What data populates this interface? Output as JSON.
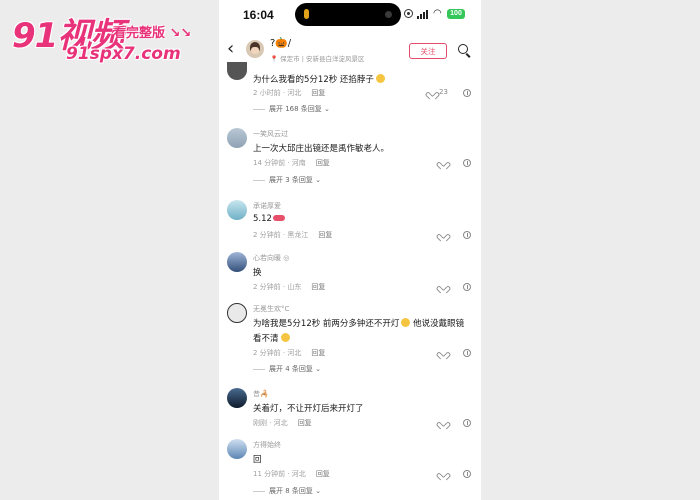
{
  "watermark": {
    "main": "91视频",
    "side": "看完整版 ↘↘",
    "url": "91spx7.com"
  },
  "status": {
    "time": "16:04",
    "battery": "100"
  },
  "header": {
    "back": "‹",
    "name": "?🎃/",
    "sub": "📍 保定市 | 安新县白洋淀风景区",
    "follow_label": "关注"
  },
  "comments": [
    {
      "name": "",
      "text": "为什么我看的5分12秒 还掐脖子",
      "time": "2 小时前 · 河北",
      "reply": "回复",
      "likes": "23",
      "expand": "展开 168 条回复 ⌄"
    },
    {
      "name": "一笑风云过",
      "text": "上一次大邱庄出镜还是禹作敏老人。",
      "time": "14 分钟前 · 河南",
      "reply": "回复",
      "likes": "",
      "expand": "展开 3 条回复 ⌄"
    },
    {
      "name": "承诺厚爱",
      "text": "5.12",
      "time": "2 分钟前 · 黑龙江",
      "reply": "回复",
      "likes": "",
      "expand": ""
    },
    {
      "name": "心若向暖 ◎",
      "text": "换",
      "time": "2 分钟前 · 山东",
      "reply": "回复",
      "likes": "",
      "expand": ""
    },
    {
      "name": "无冕生欢°C",
      "text": "为啥我是5分12秒 前两分多钟还不开灯",
      "text_tail": " 他说没戴眼镜",
      "text2": "看不清",
      "time": "2 分钟前 · 河北",
      "reply": "回复",
      "likes": "",
      "expand": "展开 4 条回复 ⌄"
    },
    {
      "name": "昔🦂",
      "text": "关着灯，不让开灯后来开灯了",
      "time": "刚刚 · 河北",
      "reply": "回复",
      "likes": "",
      "expand": ""
    },
    {
      "name": "方得始终",
      "text": "回",
      "time": "11 分钟前 · 河北",
      "reply": "回复",
      "likes": "",
      "expand": "展开 8 条回复 ⌄"
    }
  ],
  "colors": {
    "accent": "#e74c6b",
    "watermark": "#e8327a"
  }
}
